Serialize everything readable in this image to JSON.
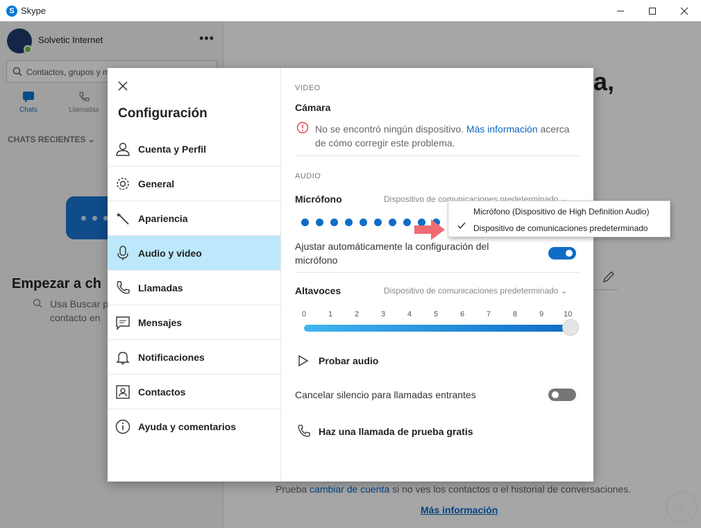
{
  "window": {
    "title": "Skype"
  },
  "sidebar": {
    "profile_name": "Solvetic Internet",
    "search_placeholder": "Contactos, grupos y m",
    "tabs": [
      {
        "label": "Chats"
      },
      {
        "label": "Llamadas"
      }
    ],
    "recents_label": "CHATS RECIENTES",
    "empty_title": "Empezar a ch",
    "empty_hint_line1": "Usa Buscar p",
    "empty_hint_line2": "contacto en"
  },
  "main": {
    "heading_fragment": "a,",
    "footer_prefix": "Prueba",
    "footer_link": "cambiar de cuenta",
    "footer_suffix": "si no ves los contactos o el historial de conversaciones.",
    "more_info": "Más información"
  },
  "settings": {
    "title": "Configuración",
    "menu": [
      {
        "label": "Cuenta y Perfil",
        "icon": "person-icon"
      },
      {
        "label": "General",
        "icon": "gear-icon"
      },
      {
        "label": "Apariencia",
        "icon": "magic-wand-icon"
      },
      {
        "label": "Audio y video",
        "icon": "microphone-icon",
        "active": true
      },
      {
        "label": "Llamadas",
        "icon": "phone-icon"
      },
      {
        "label": "Mensajes",
        "icon": "message-icon"
      },
      {
        "label": "Notificaciones",
        "icon": "bell-icon"
      },
      {
        "label": "Contactos",
        "icon": "contacts-icon"
      },
      {
        "label": "Ayuda y comentarios",
        "icon": "info-icon"
      }
    ],
    "video_section": "VIDEO",
    "camera_label": "Cámara",
    "camera_error": "No se encontró ningún dispositivo.",
    "camera_error_link": "Más información",
    "camera_error_suffix": "acerca de cómo corregir este problema.",
    "audio_section": "AUDIO",
    "mic_label": "Micrófono",
    "mic_device": "Dispositivo de comunicaciones predeterminado",
    "mic_level_dots": 10,
    "auto_adjust_label": "Ajustar automáticamente la configuración del micrófono",
    "auto_adjust_on": true,
    "speakers_label": "Altavoces",
    "speakers_device": "Dispositivo de comunicaciones predeterminado",
    "volume_ticks": [
      "0",
      "1",
      "2",
      "3",
      "4",
      "5",
      "6",
      "7",
      "8",
      "9",
      "10"
    ],
    "volume_value": 10,
    "test_audio": "Probar audio",
    "unmute_incoming_label": "Cancelar silencio para llamadas entrantes",
    "unmute_incoming_on": false,
    "free_test_call": "Haz una llamada de prueba gratis"
  },
  "mic_dropdown": {
    "options": [
      {
        "label": "Micrófono (Dispositivo de High Definition Audio)",
        "selected": false
      },
      {
        "label": "Dispositivo de comunicaciones predeterminado",
        "selected": true
      }
    ]
  },
  "colors": {
    "accent": "#0078d7",
    "active_menu": "#bde8fb",
    "toggle_on": "#0f6dc6",
    "toggle_off": "#767676",
    "link": "#0a67c9",
    "arrow": "#f06c72"
  }
}
